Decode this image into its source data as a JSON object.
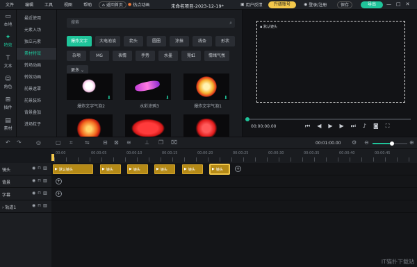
{
  "menu": [
    "文件",
    "编辑",
    "工具",
    "视图",
    "帮助"
  ],
  "titlebar": {
    "home_label": "返回首页",
    "hot_label": "热点动画",
    "project_title": "未命名项目-2023-12-19*",
    "feedback_label": "用户反馈",
    "upgrade_label": "升级账号",
    "login_label": "登录/注册",
    "save_label": "保存",
    "export_label": "导出"
  },
  "rail": [
    {
      "label": "本地",
      "icon": "folder-icon"
    },
    {
      "label": "特效",
      "icon": "sparkle-icon"
    },
    {
      "label": "文本",
      "icon": "text-icon"
    },
    {
      "label": "角色",
      "icon": "person-icon"
    },
    {
      "label": "插件",
      "icon": "plugin-icon"
    },
    {
      "label": "素材",
      "icon": "material-icon"
    }
  ],
  "categories": [
    "最近使用",
    "元素入场",
    "独立元素",
    "素材特效",
    "转场动画",
    "转效动画",
    "前景遮罩",
    "前景装饰",
    "背景叠加",
    "进场粒子"
  ],
  "search": {
    "placeholder": "搜索"
  },
  "tags": [
    "爆炸文字",
    "大电池谈",
    "箭头",
    "圆圈",
    "涂抹",
    "线条",
    "形状",
    "杂项",
    "MG",
    "表情",
    "手势",
    "水墨",
    "霓虹",
    "情绪气氛",
    "更多"
  ],
  "thumbnails": [
    {
      "caption": "爆炸文字气泡2"
    },
    {
      "caption": "水彩涂鸦3"
    },
    {
      "caption": "爆炸文字气泡1"
    },
    {
      "caption": ""
    },
    {
      "caption": ""
    },
    {
      "caption": ""
    }
  ],
  "preview": {
    "canvas_label": "默认镜头",
    "time": "00:00:00.00"
  },
  "timeline": {
    "duration": "00:01:00.00",
    "zoom_level": 0.55,
    "ruler": [
      "00:00",
      "00:00:05",
      "00:00:10",
      "00:00:15",
      "00:00:20",
      "00:00:25",
      "00:00:30",
      "00:00:35",
      "00:00:40",
      "00:00:45"
    ],
    "tracks": [
      {
        "name": "镜头"
      },
      {
        "name": "背景"
      },
      {
        "name": "字幕"
      },
      {
        "name": "轨道1"
      }
    ],
    "clips": [
      {
        "label": "默认镜头"
      },
      {
        "label": "镜头"
      },
      {
        "label": "镜头"
      },
      {
        "label": "镜头"
      },
      {
        "label": "镜头"
      },
      {
        "label": "镜头"
      }
    ]
  },
  "watermark": "IT猫扑下载站",
  "colors": {
    "accent": "#1fc49a",
    "upgrade": "#f3c84b",
    "clip": "#b58a17"
  }
}
